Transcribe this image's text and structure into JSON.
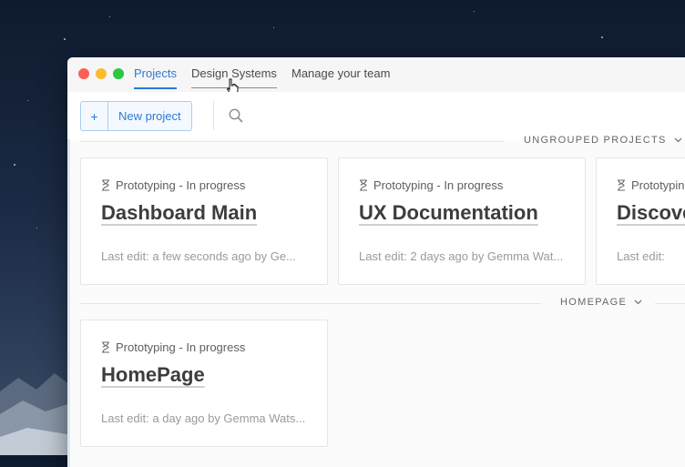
{
  "tabs": [
    "Projects",
    "Design Systems",
    "Manage your team"
  ],
  "toolbar": {
    "plus_label": "+",
    "new_project_label": "New project"
  },
  "groups": [
    {
      "header": "UNGROUPED PROJECTS",
      "cards": [
        {
          "status": "Prototyping - In progress",
          "title": "Dashboard Main",
          "edit": "Last edit: a few seconds ago by Ge..."
        },
        {
          "status": "Prototyping - In progress",
          "title": "UX Documentation",
          "edit": "Last edit: 2 days ago by Gemma Wat..."
        },
        {
          "status": "Prototyping",
          "title": "Discove",
          "edit": "Last edit:"
        }
      ]
    },
    {
      "header": "HOMEPAGE",
      "cards": [
        {
          "status": "Prototyping - In progress",
          "title": "HomePage",
          "edit": "Last edit: a day ago by Gemma Wats..."
        }
      ]
    }
  ],
  "colors": {
    "accent": "#2a7ad8",
    "close": "#fc5f57",
    "minimize": "#fdbc2e",
    "maximize": "#29c840"
  }
}
